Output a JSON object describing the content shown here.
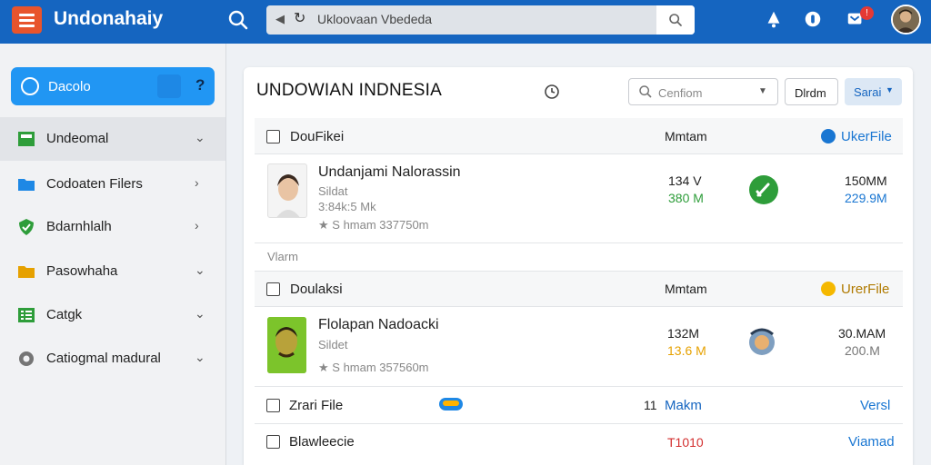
{
  "app": {
    "title": "Undonahaiy"
  },
  "address": {
    "text": "Ukloovaan Vbededa"
  },
  "sidebar": {
    "primary_label": "Dacolo",
    "primary_help": "?",
    "items": [
      {
        "label": "Undeomal"
      },
      {
        "label": "Codoaten Filers"
      },
      {
        "label": "Bdarnhlalh"
      },
      {
        "label": "Pasowhaha"
      },
      {
        "label": "Catgk"
      },
      {
        "label": "Catiogmal madural"
      }
    ]
  },
  "main": {
    "title": "UNDOWIAN INDNESIA",
    "search_placeholder": "Cenfiom",
    "btn_plain": "Dlrdm",
    "btn_primary": "Sarai",
    "group1": {
      "header_name": "DouFikei",
      "header_col": "Mmtam",
      "header_action": "UkerFile",
      "item_name": "Undanjami Nalorassin",
      "item_sub1": "Sildat",
      "item_sub2": "3:84k:5 Mk",
      "item_meta": "S hmam 337750m",
      "val_a": "134 V",
      "val_b": "380 M",
      "val_c": "150MM",
      "val_d": "229.9M"
    },
    "section_label": "Vlarm",
    "group2": {
      "header_name": "Doulaksi",
      "header_col": "Mmtam",
      "header_action": "UrerFile",
      "item_name": "Flolapan Nadoacki",
      "item_sub1": "Sildet",
      "item_meta": "S hmam 357560m",
      "val_a": "132M",
      "val_b": "13.6 M",
      "val_c": "30.MAM",
      "val_d": "200.M"
    },
    "row3": {
      "name": "Zrari File",
      "num": "11",
      "col": "Makm",
      "action": "Versl"
    },
    "row4": {
      "name": "Blawleecie",
      "col": "T1010",
      "action": "Viamad"
    }
  },
  "colors": {
    "topbar": "#1565c0",
    "accent": "#2196f3",
    "menu": "#e8542c"
  }
}
